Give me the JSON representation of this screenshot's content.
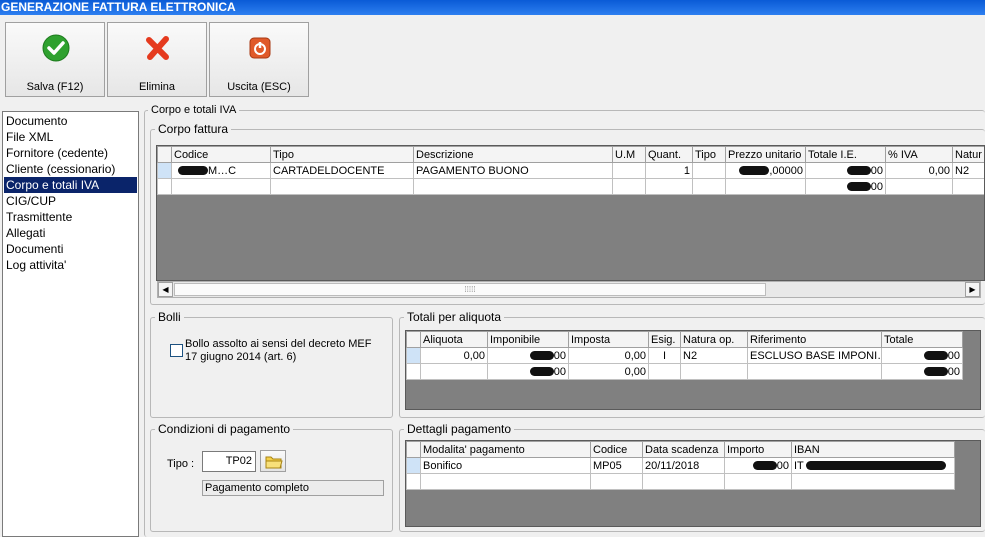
{
  "window": {
    "title": "GENERAZIONE FATTURA ELETTRONICA"
  },
  "toolbar": {
    "save_label": "Salva (F12)",
    "delete_label": "Elimina",
    "exit_label": "Uscita (ESC)"
  },
  "nav": {
    "items": [
      {
        "label": "Documento"
      },
      {
        "label": "File XML"
      },
      {
        "label": "Fornitore (cedente)"
      },
      {
        "label": "Cliente (cessionario)"
      },
      {
        "label": "Corpo e totali IVA",
        "selected": true
      },
      {
        "label": "CIG/CUP"
      },
      {
        "label": "Trasmittente"
      },
      {
        "label": "Allegati"
      },
      {
        "label": "Documenti"
      },
      {
        "label": "Log attivita'"
      }
    ]
  },
  "section_title": "Corpo e totali IVA",
  "corpo": {
    "title": "Corpo fattura",
    "columns": [
      "Codice",
      "Tipo",
      "Descrizione",
      "U.M",
      "Quant.",
      "Tipo",
      "Prezzo unitario",
      "Totale I.E.",
      "% IVA",
      "Natur"
    ],
    "rows": [
      [
        "M…C",
        "CARTADELDOCENTE",
        "PAGAMENTO BUONO",
        "",
        "1",
        "",
        ",00000",
        "00",
        "0,00",
        "N2"
      ],
      [
        "",
        "",
        "",
        "",
        "",
        "",
        "",
        "00",
        "",
        ""
      ]
    ]
  },
  "bolli": {
    "title": "Bolli",
    "checkbox_label_line1": "Bollo assolto ai sensi del decreto MEF",
    "checkbox_label_line2": "17 giugno 2014 (art. 6)",
    "checked": false
  },
  "totali": {
    "title": "Totali per aliquota",
    "columns": [
      "Aliquota",
      "Imponibile",
      "Imposta",
      "Esig.",
      "Natura op.",
      "Riferimento",
      "Totale"
    ],
    "rows": [
      [
        "0,00",
        "00",
        "0,00",
        "I",
        "N2",
        "ESCLUSO BASE IMPONI…",
        "00"
      ],
      [
        "",
        "00",
        "0,00",
        "",
        "",
        "",
        "00"
      ]
    ]
  },
  "condizioni": {
    "title": "Condizioni di pagamento",
    "tipo_label": "Tipo :",
    "tipo_value": "TP02",
    "description": "Pagamento completo"
  },
  "dettagli": {
    "title": "Dettagli pagamento",
    "columns": [
      "Modalita' pagamento",
      "Codice",
      "Data scadenza",
      "Importo",
      "IBAN"
    ],
    "rows": [
      [
        "Bonifico",
        "MP05",
        "20/11/2018",
        "00",
        "IT"
      ],
      [
        "",
        "",
        "",
        "",
        ""
      ]
    ]
  },
  "colors": {
    "titlebar": "#0a5bd6",
    "nav_selected": "#0a246a",
    "save_icon": "#2fa12f",
    "delete_icon": "#e53a1e",
    "exit_icon": "#e05a2a"
  }
}
